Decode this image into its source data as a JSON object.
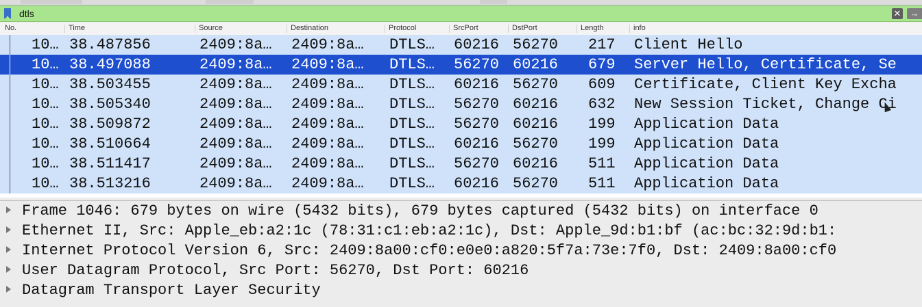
{
  "filter": {
    "value": "dtls"
  },
  "columns": [
    "No.",
    "Time",
    "Source",
    "Destination",
    "Protocol",
    "SrcPort",
    "DstPort",
    "Length",
    "info"
  ],
  "packets": [
    {
      "no": "10…",
      "time": "38.487856",
      "src": "2409:8a…",
      "dst": "2409:8a…",
      "proto": "DTLS…",
      "srcport": "60216",
      "dstport": "56270",
      "len": "217",
      "info": "Client Hello"
    },
    {
      "no": "10…",
      "time": "38.497088",
      "src": "2409:8a…",
      "dst": "2409:8a…",
      "proto": "DTLS…",
      "srcport": "56270",
      "dstport": "60216",
      "len": "679",
      "info": "Server Hello, Certificate, Se"
    },
    {
      "no": "10…",
      "time": "38.503455",
      "src": "2409:8a…",
      "dst": "2409:8a…",
      "proto": "DTLS…",
      "srcport": "60216",
      "dstport": "56270",
      "len": "609",
      "info": "Certificate, Client Key Excha"
    },
    {
      "no": "10…",
      "time": "38.505340",
      "src": "2409:8a…",
      "dst": "2409:8a…",
      "proto": "DTLS…",
      "srcport": "56270",
      "dstport": "60216",
      "len": "632",
      "info": "New Session Ticket, Change Ci"
    },
    {
      "no": "10…",
      "time": "38.509872",
      "src": "2409:8a…",
      "dst": "2409:8a…",
      "proto": "DTLS…",
      "srcport": "56270",
      "dstport": "60216",
      "len": "199",
      "info": "Application Data"
    },
    {
      "no": "10…",
      "time": "38.510664",
      "src": "2409:8a…",
      "dst": "2409:8a…",
      "proto": "DTLS…",
      "srcport": "60216",
      "dstport": "56270",
      "len": "199",
      "info": "Application Data"
    },
    {
      "no": "10…",
      "time": "38.511417",
      "src": "2409:8a…",
      "dst": "2409:8a…",
      "proto": "DTLS…",
      "srcport": "56270",
      "dstport": "60216",
      "len": "511",
      "info": "Application Data"
    },
    {
      "no": "10…",
      "time": "38.513216",
      "src": "2409:8a…",
      "dst": "2409:8a…",
      "proto": "DTLS…",
      "srcport": "60216",
      "dstport": "56270",
      "len": "511",
      "info": "Application Data"
    }
  ],
  "details": [
    "Frame 1046: 679 bytes on wire (5432 bits), 679 bytes captured (5432 bits) on interface 0",
    "Ethernet II, Src: Apple_eb:a2:1c (78:31:c1:eb:a2:1c), Dst: Apple_9d:b1:bf (ac:bc:32:9d:b1:",
    "Internet Protocol Version 6, Src: 2409:8a00:cf0:e0e0:a820:5f7a:73e:7f0, Dst: 2409:8a00:cf0",
    "User Datagram Protocol, Src Port: 56270, Dst Port: 60216",
    "Datagram Transport Layer Security"
  ],
  "icons": {
    "clear": "clear-filter-icon",
    "apply": "apply-filter-icon",
    "bookmark": "filter-bookmark-icon"
  },
  "colors": {
    "selected_row": "#1d4fcf",
    "row": "#cfe2fa",
    "filter_ok": "#a9e58f"
  }
}
